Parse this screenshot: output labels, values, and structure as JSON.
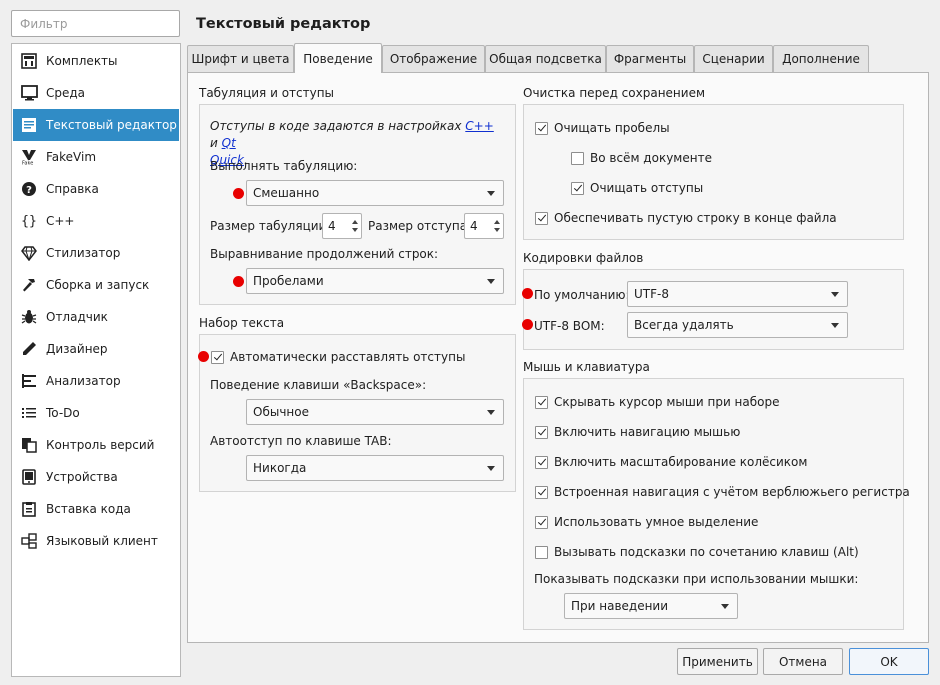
{
  "filter": {
    "placeholder": "Фильтр"
  },
  "sidebar": {
    "items": [
      {
        "label": "Комплекты",
        "icon": "kits-icon"
      },
      {
        "label": "Среда",
        "icon": "monitor-icon"
      },
      {
        "label": "Текстовый редактор",
        "icon": "text-editor-icon",
        "selected": true
      },
      {
        "label": "FakeVim",
        "icon": "fakevim-icon"
      },
      {
        "label": "Справка",
        "icon": "help-icon"
      },
      {
        "label": "C++",
        "icon": "cpp-braces-icon"
      },
      {
        "label": "Стилизатор",
        "icon": "diamond-icon"
      },
      {
        "label": "Сборка и запуск",
        "icon": "hammer-icon"
      },
      {
        "label": "Отладчик",
        "icon": "bug-icon"
      },
      {
        "label": "Дизайнер",
        "icon": "pen-icon"
      },
      {
        "label": "Анализатор",
        "icon": "analyzer-icon"
      },
      {
        "label": "To-Do",
        "icon": "list-icon"
      },
      {
        "label": "Контроль версий",
        "icon": "vcs-icon"
      },
      {
        "label": "Устройства",
        "icon": "device-icon"
      },
      {
        "label": "Вставка кода",
        "icon": "paste-icon"
      },
      {
        "label": "Языковый клиент",
        "icon": "language-client-icon"
      }
    ]
  },
  "header": {
    "title": "Текстовый редактор"
  },
  "tabs": [
    {
      "label": "Шрифт и цвета"
    },
    {
      "label": "Поведение",
      "active": true
    },
    {
      "label": "Отображение"
    },
    {
      "label": "Общая подсветка"
    },
    {
      "label": "Фрагменты"
    },
    {
      "label": "Сценарии"
    },
    {
      "label": "Дополнение"
    }
  ],
  "tabulation": {
    "title": "Табуляция и отступы",
    "note_prefix": "Отступы в коде задаются в настройках ",
    "note_link1": "C++",
    "note_mid": " и ",
    "note_link2a": "Qt",
    "note_link2b": "Quick",
    "note_suffix": ".",
    "perform_label": "Выполнять табуляцию:",
    "perform_value": "Смешанно",
    "tab_size_label": "Размер табуляции:",
    "tab_size_value": "4",
    "indent_size_label": "Размер отступа:",
    "indent_size_value": "4",
    "align_label": "Выравнивание продолжений строк:",
    "align_value": "Пробелами"
  },
  "typing": {
    "title": "Набор текста",
    "auto_indent_label": "Автоматически расставлять отступы",
    "auto_indent_checked": true,
    "backspace_label": "Поведение клавиши «Backspace»:",
    "backspace_value": "Обычное",
    "tab_key_label": "Автоотступ по клавише TAB:",
    "tab_key_value": "Никогда"
  },
  "cleanup": {
    "title": "Очистка перед сохранением",
    "items": [
      {
        "label": "Очищать пробелы",
        "checked": true
      },
      {
        "label": "Во всём документе",
        "checked": false
      },
      {
        "label": "Очищать отступы",
        "checked": true
      },
      {
        "label": "Обеспечивать пустую строку в конце файла",
        "checked": true
      }
    ]
  },
  "encodings": {
    "title": "Кодировки файлов",
    "default_label": "По умолчанию:",
    "default_value": "UTF-8",
    "bom_label": "UTF-8 BOM:",
    "bom_value": "Всегда удалять"
  },
  "mouse": {
    "title": "Мышь и клавиатура",
    "items": [
      {
        "label": "Скрывать курсор мыши при наборе",
        "checked": true
      },
      {
        "label": "Включить навигацию мышью",
        "checked": true
      },
      {
        "label": "Включить масштабирование колёсиком",
        "checked": true
      },
      {
        "label": "Встроенная навигация с учётом верблюжьего регистра",
        "checked": true
      },
      {
        "label": "Использовать умное выделение",
        "checked": true
      },
      {
        "label": "Вызывать подсказки по сочетанию клавиш (Alt)",
        "checked": false
      }
    ],
    "tooltip_label": "Показывать подсказки при использовании мышки:",
    "tooltip_value": "При наведении"
  },
  "buttons": {
    "apply": "Применить",
    "cancel": "Отмена",
    "ok": "OK"
  },
  "colors": {
    "selection": "#308cc6",
    "marker": "#e80000",
    "link": "#1030d0"
  }
}
